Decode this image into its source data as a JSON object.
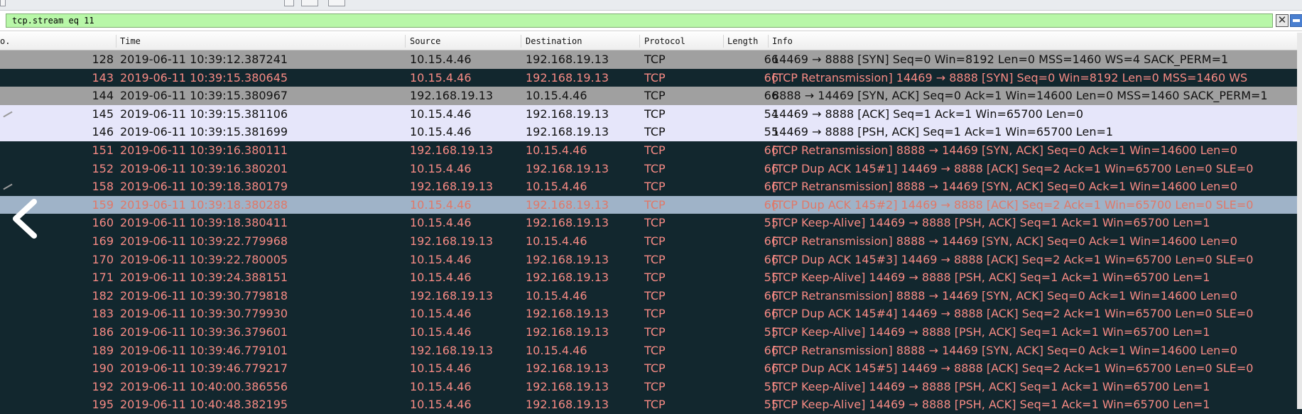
{
  "filter": {
    "value": "tcp.stream eq 11"
  },
  "columns": {
    "no": "o.",
    "time": "Time",
    "source": "Source",
    "destination": "Destination",
    "protocol": "Protocol",
    "length": "Length",
    "info": "Info"
  },
  "colors": {
    "row_gray": "#a0a0a0",
    "row_light": "#e6e6fa",
    "row_dark": "#12272e",
    "row_dark_text": "#f78a84",
    "row_selected": "#9fb3c8",
    "filter_valid": "#b8f7a8"
  },
  "icons": {
    "clear": "clear-filter-icon",
    "apply": "apply-filter-icon",
    "back": "chevron-left-icon"
  },
  "packets": [
    {
      "no": "128",
      "time": "2019-06-11 10:39:12.387241",
      "source": "10.15.4.46",
      "destination": "192.168.19.13",
      "protocol": "TCP",
      "length": "66",
      "info": "14469 → 8888 [SYN] Seq=0 Win=8192 Len=0 MSS=1460 WS=4 SACK_PERM=1",
      "style": "gray"
    },
    {
      "no": "143",
      "time": "2019-06-11 10:39:15.380645",
      "source": "10.15.4.46",
      "destination": "192.168.19.13",
      "protocol": "TCP",
      "length": "66",
      "info": "[TCP Retransmission] 14469 → 8888 [SYN] Seq=0 Win=8192 Len=0 MSS=1460 WS",
      "style": "dark"
    },
    {
      "no": "144",
      "time": "2019-06-11 10:39:15.380967",
      "source": "192.168.19.13",
      "destination": "10.15.4.46",
      "protocol": "TCP",
      "length": "66",
      "info": "8888 → 14469 [SYN, ACK] Seq=0 Ack=1 Win=14600 Len=0 MSS=1460 SACK_PERM=1",
      "style": "gray"
    },
    {
      "no": "145",
      "time": "2019-06-11 10:39:15.381106",
      "source": "10.15.4.46",
      "destination": "192.168.19.13",
      "protocol": "TCP",
      "length": "54",
      "info": "14469 → 8888 [ACK] Seq=1 Ack=1 Win=65700 Len=0",
      "style": "light"
    },
    {
      "no": "146",
      "time": "2019-06-11 10:39:15.381699",
      "source": "10.15.4.46",
      "destination": "192.168.19.13",
      "protocol": "TCP",
      "length": "55",
      "info": "14469 → 8888 [PSH, ACK] Seq=1 Ack=1 Win=65700 Len=1",
      "style": "light"
    },
    {
      "no": "151",
      "time": "2019-06-11 10:39:16.380111",
      "source": "192.168.19.13",
      "destination": "10.15.4.46",
      "protocol": "TCP",
      "length": "66",
      "info": "[TCP Retransmission] 8888 → 14469 [SYN, ACK] Seq=0 Ack=1 Win=14600 Len=0",
      "style": "dark"
    },
    {
      "no": "152",
      "time": "2019-06-11 10:39:16.380201",
      "source": "10.15.4.46",
      "destination": "192.168.19.13",
      "protocol": "TCP",
      "length": "66",
      "info": "[TCP Dup ACK 145#1] 14469 → 8888 [ACK] Seq=2 Ack=1 Win=65700 Len=0 SLE=0",
      "style": "dark"
    },
    {
      "no": "158",
      "time": "2019-06-11 10:39:18.380179",
      "source": "192.168.19.13",
      "destination": "10.15.4.46",
      "protocol": "TCP",
      "length": "66",
      "info": "[TCP Retransmission] 8888 → 14469 [SYN, ACK] Seq=0 Ack=1 Win=14600 Len=0",
      "style": "dark"
    },
    {
      "no": "159",
      "time": "2019-06-11 10:39:18.380288",
      "source": "10.15.4.46",
      "destination": "192.168.19.13",
      "protocol": "TCP",
      "length": "66",
      "info": "[TCP Dup ACK 145#2] 14469 → 8888 [ACK] Seq=2 Ack=1 Win=65700 Len=0 SLE=0",
      "style": "sel"
    },
    {
      "no": "160",
      "time": "2019-06-11 10:39:18.380411",
      "source": "10.15.4.46",
      "destination": "192.168.19.13",
      "protocol": "TCP",
      "length": "55",
      "info": "[TCP Keep-Alive] 14469 → 8888 [PSH, ACK] Seq=1 Ack=1 Win=65700 Len=1",
      "style": "dark"
    },
    {
      "no": "169",
      "time": "2019-06-11 10:39:22.779968",
      "source": "192.168.19.13",
      "destination": "10.15.4.46",
      "protocol": "TCP",
      "length": "66",
      "info": "[TCP Retransmission] 8888 → 14469 [SYN, ACK] Seq=0 Ack=1 Win=14600 Len=0",
      "style": "dark"
    },
    {
      "no": "170",
      "time": "2019-06-11 10:39:22.780005",
      "source": "10.15.4.46",
      "destination": "192.168.19.13",
      "protocol": "TCP",
      "length": "66",
      "info": "[TCP Dup ACK 145#3] 14469 → 8888 [ACK] Seq=2 Ack=1 Win=65700 Len=0 SLE=0",
      "style": "dark"
    },
    {
      "no": "171",
      "time": "2019-06-11 10:39:24.388151",
      "source": "10.15.4.46",
      "destination": "192.168.19.13",
      "protocol": "TCP",
      "length": "55",
      "info": "[TCP Keep-Alive] 14469 → 8888 [PSH, ACK] Seq=1 Ack=1 Win=65700 Len=1",
      "style": "dark"
    },
    {
      "no": "182",
      "time": "2019-06-11 10:39:30.779818",
      "source": "192.168.19.13",
      "destination": "10.15.4.46",
      "protocol": "TCP",
      "length": "66",
      "info": "[TCP Retransmission] 8888 → 14469 [SYN, ACK] Seq=0 Ack=1 Win=14600 Len=0",
      "style": "dark"
    },
    {
      "no": "183",
      "time": "2019-06-11 10:39:30.779930",
      "source": "10.15.4.46",
      "destination": "192.168.19.13",
      "protocol": "TCP",
      "length": "66",
      "info": "[TCP Dup ACK 145#4] 14469 → 8888 [ACK] Seq=2 Ack=1 Win=65700 Len=0 SLE=0",
      "style": "dark"
    },
    {
      "no": "186",
      "time": "2019-06-11 10:39:36.379601",
      "source": "10.15.4.46",
      "destination": "192.168.19.13",
      "protocol": "TCP",
      "length": "55",
      "info": "[TCP Keep-Alive] 14469 → 8888 [PSH, ACK] Seq=1 Ack=1 Win=65700 Len=1",
      "style": "dark"
    },
    {
      "no": "189",
      "time": "2019-06-11 10:39:46.779101",
      "source": "192.168.19.13",
      "destination": "10.15.4.46",
      "protocol": "TCP",
      "length": "66",
      "info": "[TCP Retransmission] 8888 → 14469 [SYN, ACK] Seq=0 Ack=1 Win=14600 Len=0",
      "style": "dark"
    },
    {
      "no": "190",
      "time": "2019-06-11 10:39:46.779217",
      "source": "10.15.4.46",
      "destination": "192.168.19.13",
      "protocol": "TCP",
      "length": "66",
      "info": "[TCP Dup ACK 145#5] 14469 → 8888 [ACK] Seq=2 Ack=1 Win=65700 Len=0 SLE=0",
      "style": "dark"
    },
    {
      "no": "192",
      "time": "2019-06-11 10:40:00.386556",
      "source": "10.15.4.46",
      "destination": "192.168.19.13",
      "protocol": "TCP",
      "length": "55",
      "info": "[TCP Keep-Alive] 14469 → 8888 [PSH, ACK] Seq=1 Ack=1 Win=65700 Len=1",
      "style": "dark"
    },
    {
      "no": "195",
      "time": "2019-06-11 10:40:48.382195",
      "source": "10.15.4.46",
      "destination": "192.168.19.13",
      "protocol": "TCP",
      "length": "55",
      "info": "[TCP Keep-Alive] 14469 → 8888 [PSH, ACK] Seq=1 Ack=1 Win=65700 Len=1",
      "style": "dark"
    }
  ]
}
